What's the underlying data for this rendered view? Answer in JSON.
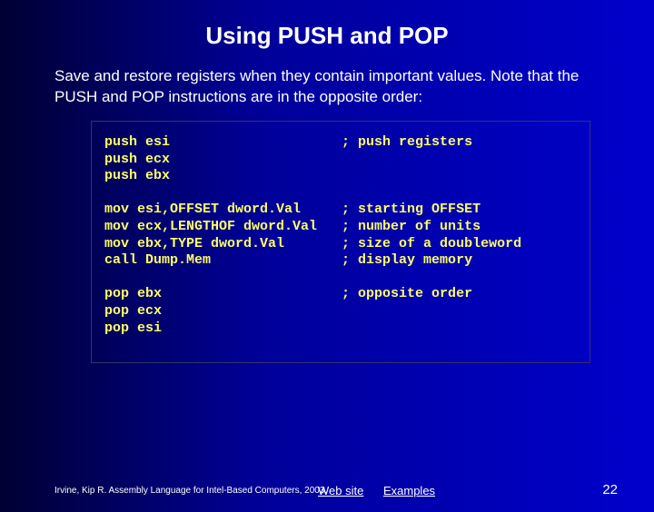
{
  "title": "Using PUSH and POP",
  "description": "Save and restore registers when they contain important values. Note that the PUSH and POP instructions are in the opposite order:",
  "code": {
    "block1": {
      "l1": "push esi                     ; push registers",
      "l2": "push ecx",
      "l3": "push ebx"
    },
    "block2": {
      "l1": "mov esi,OFFSET dword.Val     ; starting OFFSET",
      "l2": "mov ecx,LENGTHOF dword.Val   ; number of units",
      "l3": "mov ebx,TYPE dword.Val       ; size of a doubleword",
      "l4": "call Dump.Mem                ; display memory"
    },
    "block3": {
      "l1": "pop ebx                      ; opposite order",
      "l2": "pop ecx",
      "l3": "pop esi"
    }
  },
  "footer": "Irvine, Kip R. Assembly Language for Intel-Based Computers, 2003.",
  "links": {
    "web": "Web site",
    "examples": "Examples"
  },
  "page": "22"
}
